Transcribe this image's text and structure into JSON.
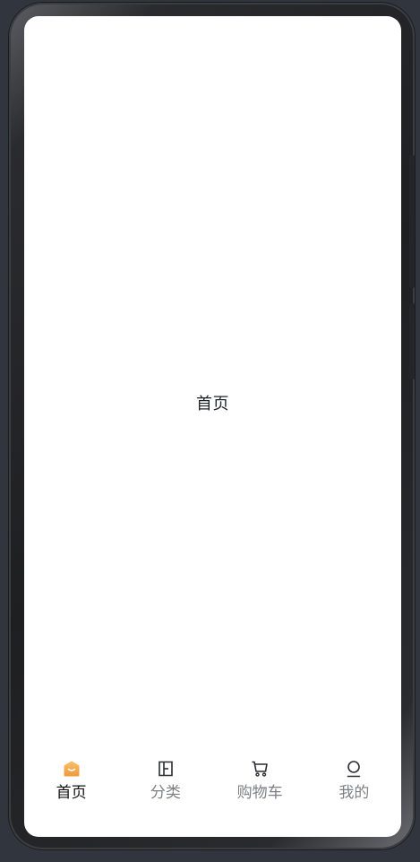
{
  "page": {
    "title": "首页"
  },
  "tabbar": {
    "active_index": 0,
    "accent_color": "#f3a74a",
    "items": [
      {
        "label": "首页",
        "icon": "home-icon"
      },
      {
        "label": "分类",
        "icon": "category-icon"
      },
      {
        "label": "购物车",
        "icon": "cart-icon"
      },
      {
        "label": "我的",
        "icon": "profile-icon"
      }
    ]
  }
}
